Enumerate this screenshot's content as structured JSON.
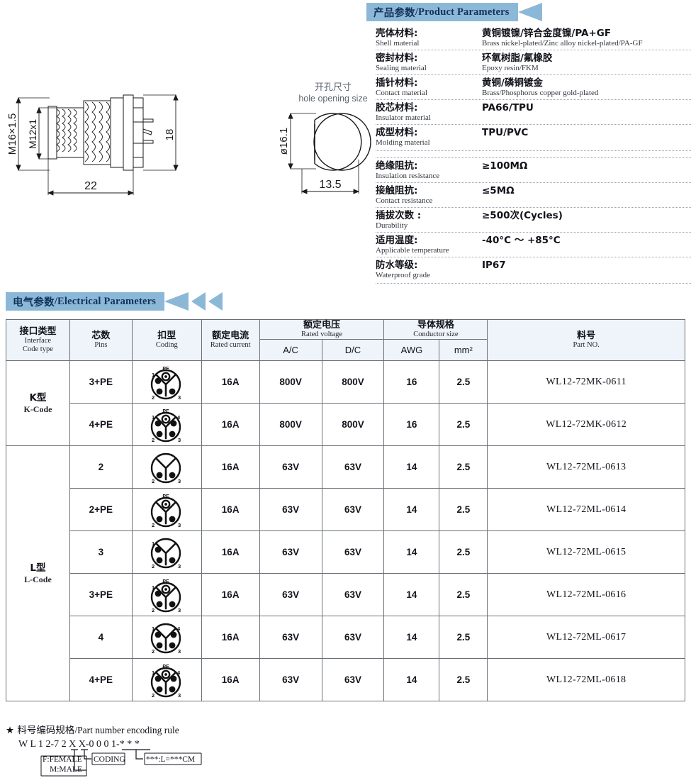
{
  "sections": {
    "product_parameters": {
      "cn": "产品参数",
      "sep": "/",
      "en": "Product Parameters"
    },
    "electrical_parameters": {
      "cn": "电气参数",
      "sep": "/",
      "en": "Electrical Parameters"
    }
  },
  "drawing_main": {
    "thread_outer": "M16×1.5",
    "thread_inner": "M12x1",
    "length": "22",
    "height": "18"
  },
  "drawing_hole": {
    "title_cn": "开孔尺寸",
    "title_en": "hole opening size",
    "diameter": "ø16.1",
    "flat_width": "13.5"
  },
  "material_params": [
    {
      "label_cn": "壳体材料:",
      "label_en": "Shell material",
      "value_cn": "黄铜镀镍/锌合金度镍/PA+GF",
      "value_en": "Brass nickel-plated/Zinc alloy nickel-plated/PA-GF"
    },
    {
      "label_cn": "密封材料:",
      "label_en": "Sealing material",
      "value_cn": "环氧树脂/氟橡胶",
      "value_en": "Epoxy resin/FKM"
    },
    {
      "label_cn": "插针材料:",
      "label_en": "Contact material",
      "value_cn": "黄铜/磷铜镀金",
      "value_en": "Brass/Phosphorus copper gold-plated"
    },
    {
      "label_cn": "胶芯材料:",
      "label_en": "Insulator material",
      "value_cn": "PA66/TPU",
      "value_en": ""
    },
    {
      "label_cn": "成型材料:",
      "label_en": "Molding material",
      "value_cn": "TPU/PVC",
      "value_en": ""
    }
  ],
  "electrical_specs": [
    {
      "label_cn": "绝缘阻抗:",
      "label_en": "Insulation resistance",
      "value": "≥100MΩ"
    },
    {
      "label_cn": "接触阻抗:",
      "label_en": "Contact resistance",
      "value": "≤5MΩ"
    },
    {
      "label_cn": "插拔次数 :",
      "label_en": "Durability",
      "value": "≥500次(Cycles)"
    },
    {
      "label_cn": "适用温度:",
      "label_en": "Applicable temperature",
      "value": "-40°C ～ +85°C"
    },
    {
      "label_cn": "防水等级:",
      "label_en": "Waterproof grade",
      "value": "IP67"
    }
  ],
  "table": {
    "headers": {
      "interface": {
        "cn": "接口类型",
        "en1": "Interface",
        "en2": "Code  type"
      },
      "pins": {
        "cn": "芯数",
        "en": "Pins"
      },
      "coding": {
        "cn": "扣型",
        "en": "Coding"
      },
      "rated_current": {
        "cn": "额定电流",
        "en": "Rated current"
      },
      "rated_voltage": {
        "cn": "额定电压",
        "en": "Rated voltage"
      },
      "ac": "A/C",
      "dc": "D/C",
      "conductor": {
        "cn": "导体规格",
        "en": "Conductor size"
      },
      "awg": "AWG",
      "mm2": "mm²",
      "part_no": {
        "cn": "料号",
        "en": "Part NO."
      }
    },
    "groups": [
      {
        "code_cn": "K型",
        "code_en": "K-Code",
        "rows": [
          {
            "pins": "3+PE",
            "pin_layout": "3pe",
            "current": "16A",
            "ac": "800V",
            "dc": "800V",
            "awg": "16",
            "mm2": "2.5",
            "part_no": "WL12-72MK-0611"
          },
          {
            "pins": "4+PE",
            "pin_layout": "4pe",
            "current": "16A",
            "ac": "800V",
            "dc": "800V",
            "awg": "16",
            "mm2": "2.5",
            "part_no": "WL12-72MK-0612"
          }
        ]
      },
      {
        "code_cn": "L型",
        "code_en": "L-Code",
        "rows": [
          {
            "pins": "2",
            "pin_layout": "2",
            "current": "16A",
            "ac": "63V",
            "dc": "63V",
            "awg": "14",
            "mm2": "2.5",
            "part_no": "WL12-72ML-0613"
          },
          {
            "pins": "2+PE",
            "pin_layout": "2pe",
            "current": "16A",
            "ac": "63V",
            "dc": "63V",
            "awg": "14",
            "mm2": "2.5",
            "part_no": "WL12-72ML-0614"
          },
          {
            "pins": "3",
            "pin_layout": "3",
            "current": "16A",
            "ac": "63V",
            "dc": "63V",
            "awg": "14",
            "mm2": "2.5",
            "part_no": "WL12-72ML-0615"
          },
          {
            "pins": "3+PE",
            "pin_layout": "3pe",
            "current": "16A",
            "ac": "63V",
            "dc": "63V",
            "awg": "14",
            "mm2": "2.5",
            "part_no": "WL12-72ML-0616"
          },
          {
            "pins": "4",
            "pin_layout": "4",
            "current": "16A",
            "ac": "63V",
            "dc": "63V",
            "awg": "14",
            "mm2": "2.5",
            "part_no": "WL12-72ML-0617"
          },
          {
            "pins": "4+PE",
            "pin_layout": "4pe",
            "current": "16A",
            "ac": "63V",
            "dc": "63V",
            "awg": "14",
            "mm2": "2.5",
            "part_no": "WL12-72ML-0618"
          }
        ]
      }
    ]
  },
  "footer": {
    "star": "★",
    "title_cn": "料号编码规格",
    "title_sep": "/",
    "title_en": "Part number encoding rule",
    "code": "W L 1 2-7 2 X X-0 0 0 1-* * *",
    "note_female": "F:FEMALE",
    "note_male": "M:MALE",
    "note_coding": "CODING",
    "note_length": "***:L=***CM"
  },
  "colors": {
    "banner": "#8cb8d8",
    "banner_text": "#12325a",
    "table_header_bg": "#eef4fa",
    "table_border": "#6b7076",
    "text": "#14161d"
  }
}
